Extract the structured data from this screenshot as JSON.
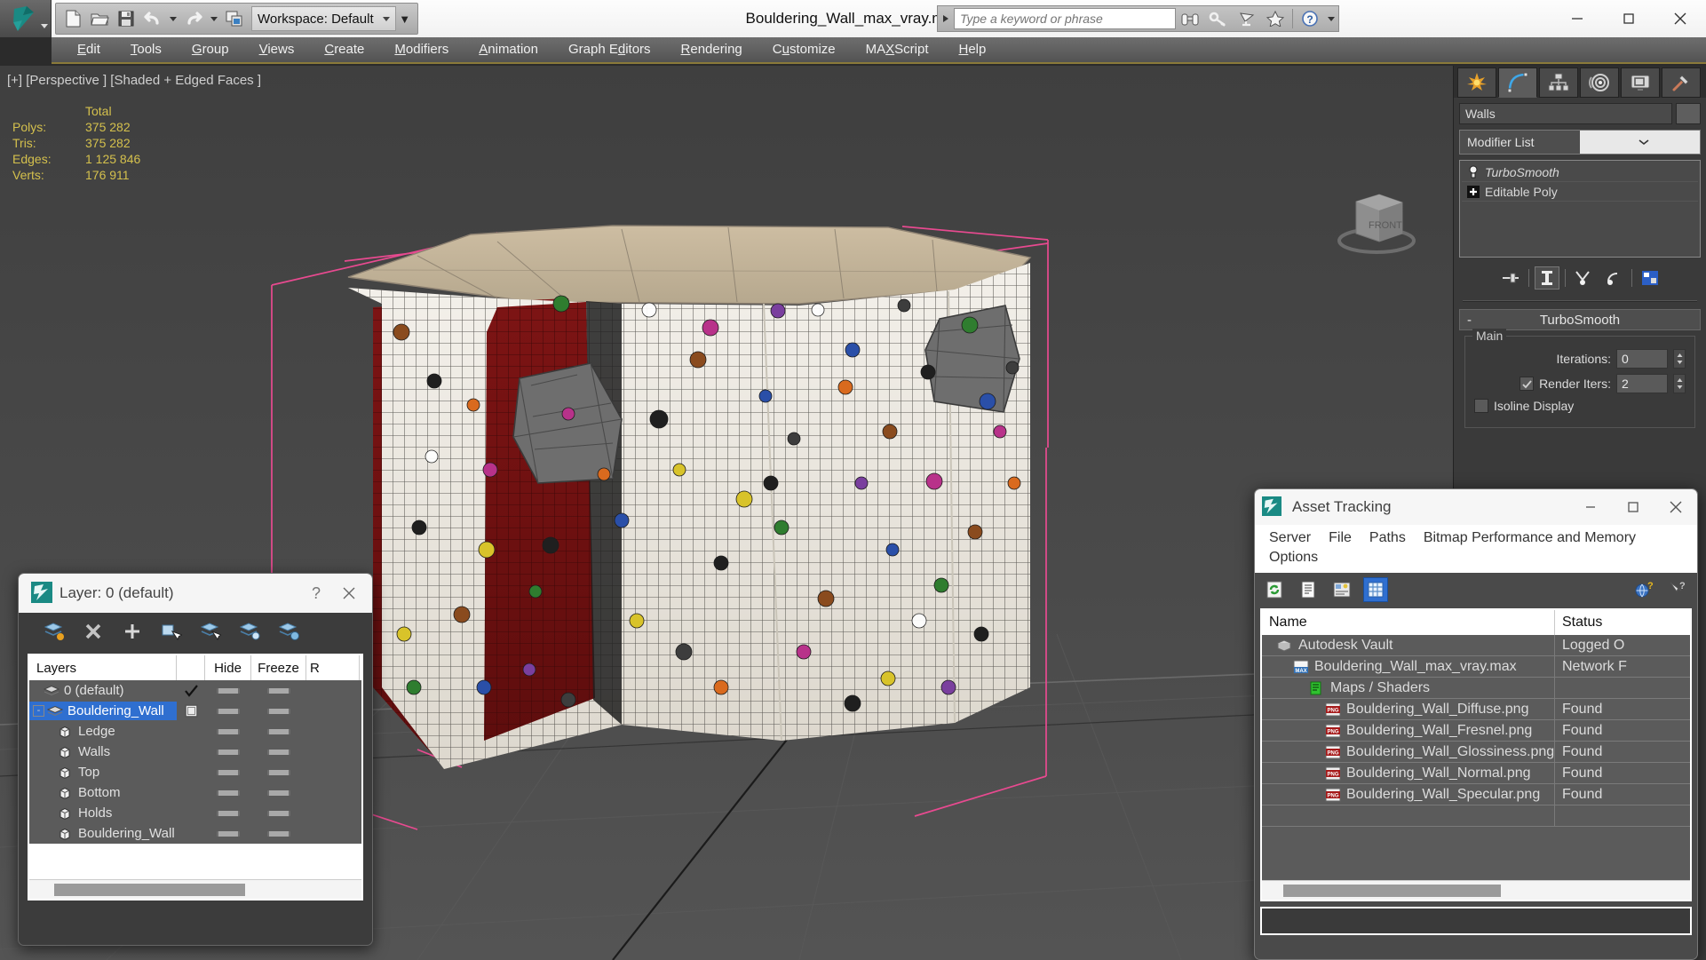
{
  "app": {
    "document_title": "Bouldering_Wall_max_vray.max",
    "workspace_label": "Workspace: Default",
    "search_placeholder": "Type a keyword or phrase"
  },
  "quick_access": [
    {
      "name": "new-file-icon",
      "label": "New"
    },
    {
      "name": "open-file-icon",
      "label": "Open"
    },
    {
      "name": "save-file-icon",
      "label": "Save"
    },
    {
      "name": "undo-icon",
      "label": "Undo"
    },
    {
      "name": "redo-icon",
      "label": "Redo"
    },
    {
      "name": "project-folder-icon",
      "label": "Set Project Folder"
    }
  ],
  "help_icons": [
    {
      "name": "binoculars-icon",
      "label": "Search"
    },
    {
      "name": "key-icon",
      "label": "Key"
    },
    {
      "name": "satellite-dish-icon",
      "label": "Communication Center"
    },
    {
      "name": "star-icon",
      "label": "Favorites"
    },
    {
      "name": "help-icon",
      "label": "Help"
    }
  ],
  "window_controls": {
    "minimize": "—",
    "maximize": "☐",
    "close": "✕"
  },
  "menubar": [
    {
      "label": "Edit",
      "mnemonic": "E"
    },
    {
      "label": "Tools",
      "mnemonic": "T"
    },
    {
      "label": "Group",
      "mnemonic": "G"
    },
    {
      "label": "Views",
      "mnemonic": "V"
    },
    {
      "label": "Create",
      "mnemonic": "C"
    },
    {
      "label": "Modifiers",
      "mnemonic": "M"
    },
    {
      "label": "Animation",
      "mnemonic": "A"
    },
    {
      "label": "Graph Editors",
      "mnemonic": "d"
    },
    {
      "label": "Rendering",
      "mnemonic": "R"
    },
    {
      "label": "Customize",
      "mnemonic": "u"
    },
    {
      "label": "MAXScript",
      "mnemonic": "X"
    },
    {
      "label": "Help",
      "mnemonic": "H"
    }
  ],
  "viewport": {
    "label": "[+] [Perspective ] [Shaded + Edged Faces ]",
    "viewcube_face": "FRONT",
    "stats": {
      "header": "Total",
      "rows": [
        {
          "label": "Polys:",
          "value": "375 282"
        },
        {
          "label": "Tris:",
          "value": "375 282"
        },
        {
          "label": "Edges:",
          "value": "1 125 846"
        },
        {
          "label": "Verts:",
          "value": "176 911"
        }
      ]
    }
  },
  "command_panel": {
    "tabs": [
      {
        "name": "create-tab",
        "icon": "star-burst-icon",
        "active": false
      },
      {
        "name": "modify-tab",
        "icon": "curve-arc-icon",
        "active": true
      },
      {
        "name": "hierarchy-tab",
        "icon": "hierarchy-icon",
        "active": false
      },
      {
        "name": "motion-tab",
        "icon": "motion-wheel-icon",
        "active": false
      },
      {
        "name": "display-tab",
        "icon": "display-monitor-icon",
        "active": false
      },
      {
        "name": "utilities-tab",
        "icon": "hammer-icon",
        "active": false
      }
    ],
    "object_name": "Walls",
    "modifier_list_label": "Modifier List",
    "stack": [
      {
        "label": "TurboSmooth",
        "icon": "lightbulb-icon",
        "italic": true
      },
      {
        "label": "Editable Poly",
        "icon": "plus-box-icon",
        "italic": false
      }
    ],
    "stack_tools": [
      {
        "name": "pin-stack-icon"
      },
      {
        "name": "show-end-result-icon"
      },
      {
        "name": "make-unique-icon"
      },
      {
        "name": "remove-modifier-icon"
      },
      {
        "name": "configure-modifier-sets-icon"
      }
    ],
    "rollout": {
      "title": "TurboSmooth",
      "collapse_glyph": "-",
      "group_label": "Main",
      "iterations_label": "Iterations:",
      "iterations_value": "0",
      "render_iters_label": "Render Iters:",
      "render_iters_value": "2",
      "render_iters_checked": true,
      "isoline_label": "Isoline Display",
      "isoline_checked": false
    }
  },
  "layer_dialog": {
    "title": "Layer: 0 (default)",
    "help_glyph": "?",
    "close_glyph": "✕",
    "toolbar": [
      {
        "name": "create-new-layer-icon"
      },
      {
        "name": "delete-layer-icon"
      },
      {
        "name": "add-layer-icon"
      },
      {
        "name": "select-objects-in-layer-icon"
      },
      {
        "name": "select-highlighted-layer-icon"
      },
      {
        "name": "highlight-selected-objects-layer-icon"
      },
      {
        "name": "layer-properties-icon"
      }
    ],
    "columns": [
      "Layers",
      "",
      "Hide",
      "Freeze",
      "R"
    ],
    "rows": [
      {
        "name": "0 (default)",
        "indent": 0,
        "icon": "layer-icon",
        "expander": "",
        "current": true,
        "selected": false,
        "hide": "dash",
        "freeze": "dash"
      },
      {
        "name": "Bouldering_Wall",
        "indent": 0,
        "icon": "layer-icon",
        "expander": "-",
        "current": false,
        "selected": true,
        "checkbox": true,
        "hide": "dash",
        "freeze": "dash"
      },
      {
        "name": "Ledge",
        "indent": 1,
        "icon": "object-icon",
        "expander": "",
        "current": false,
        "selected": false,
        "hide": "dash",
        "freeze": "dash"
      },
      {
        "name": "Walls",
        "indent": 1,
        "icon": "object-icon",
        "expander": "",
        "current": false,
        "selected": false,
        "hide": "dash",
        "freeze": "dash"
      },
      {
        "name": "Top",
        "indent": 1,
        "icon": "object-icon",
        "expander": "",
        "current": false,
        "selected": false,
        "hide": "dash",
        "freeze": "dash"
      },
      {
        "name": "Bottom",
        "indent": 1,
        "icon": "object-icon",
        "expander": "",
        "current": false,
        "selected": false,
        "hide": "dash",
        "freeze": "dash"
      },
      {
        "name": "Holds",
        "indent": 1,
        "icon": "object-icon",
        "expander": "",
        "current": false,
        "selected": false,
        "hide": "dash",
        "freeze": "dash"
      },
      {
        "name": "Bouldering_Wall",
        "indent": 1,
        "icon": "object-icon",
        "expander": "",
        "current": false,
        "selected": false,
        "hide": "dash",
        "freeze": "dash"
      }
    ]
  },
  "asset_tracking": {
    "title": "Asset Tracking",
    "menu": [
      "Server",
      "File",
      "Paths",
      "Bitmap Performance and Memory",
      "Options"
    ],
    "toolbar": [
      {
        "name": "refresh-icon",
        "selected": false
      },
      {
        "name": "list-view-icon",
        "selected": false
      },
      {
        "name": "details-view-icon",
        "selected": false
      },
      {
        "name": "grid-view-icon",
        "selected": true
      }
    ],
    "help_icons": [
      {
        "name": "web-help-icon"
      },
      {
        "name": "context-help-icon"
      }
    ],
    "columns": [
      "Name",
      "Status"
    ],
    "rows": [
      {
        "name": "Autodesk Vault",
        "status": "Logged O",
        "indent": 0,
        "icon": "vault-icon"
      },
      {
        "name": "Bouldering_Wall_max_vray.max",
        "status": "Network F",
        "indent": 1,
        "icon": "max-file-icon"
      },
      {
        "name": "Maps / Shaders",
        "status": "",
        "indent": 2,
        "icon": "maps-shaders-icon"
      },
      {
        "name": "Bouldering_Wall_Diffuse.png",
        "status": "Found",
        "indent": 3,
        "icon": "png-file-icon"
      },
      {
        "name": "Bouldering_Wall_Fresnel.png",
        "status": "Found",
        "indent": 3,
        "icon": "png-file-icon"
      },
      {
        "name": "Bouldering_Wall_Glossiness.png",
        "status": "Found",
        "indent": 3,
        "icon": "png-file-icon"
      },
      {
        "name": "Bouldering_Wall_Normal.png",
        "status": "Found",
        "indent": 3,
        "icon": "png-file-icon"
      },
      {
        "name": "Bouldering_Wall_Specular.png",
        "status": "Found",
        "indent": 3,
        "icon": "png-file-icon"
      }
    ],
    "window_controls": {
      "minimize": "—",
      "maximize": "☐",
      "close": "✕"
    }
  },
  "colors": {
    "accent_blue": "#2f6fd0",
    "stats_yellow": "#d4c04d",
    "viewport_bg": "#4a4a4a",
    "gizmo_pink": "#e84a90",
    "panel_bg": "#3a3a3a"
  }
}
